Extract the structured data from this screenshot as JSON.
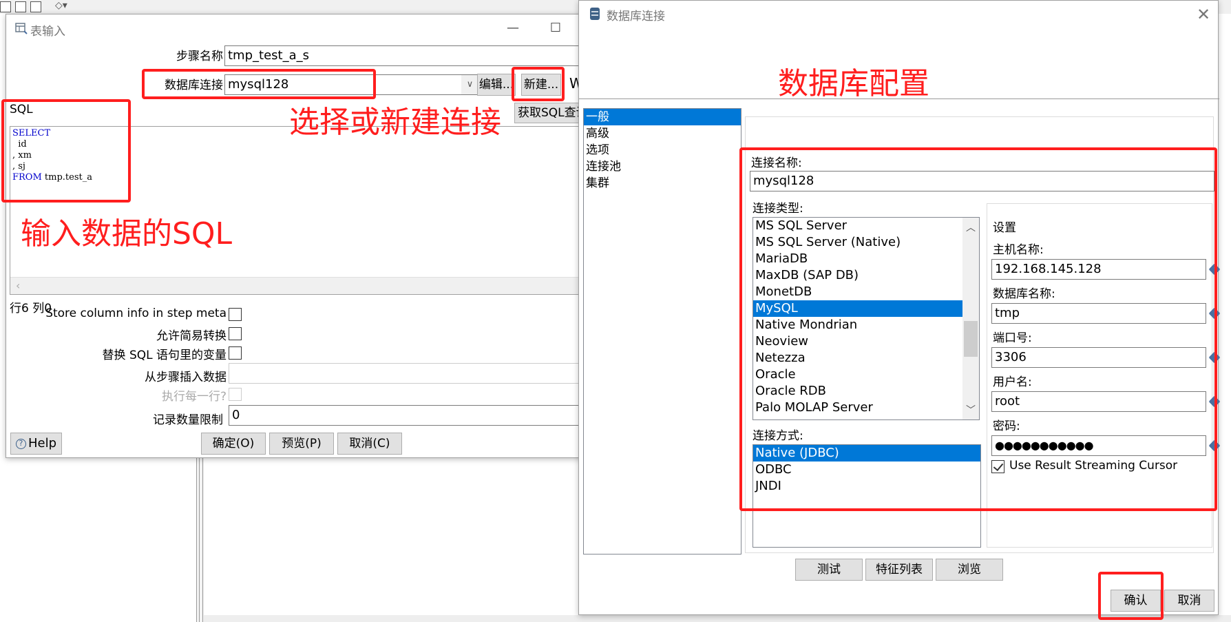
{
  "left_dialog": {
    "title": "表输入",
    "step_name_label": "步骤名称",
    "step_name_value": "tmp_test_a_s",
    "db_conn_label": "数据库连接",
    "db_conn_value": "mysql128",
    "edit_button": "编辑...",
    "new_button": "新建...",
    "wizard_button": "W",
    "get_sql_button": "获取SQL查询",
    "sql_label": "SQL",
    "sql_lines": [
      {
        "kw": "SELECT",
        "rest": ""
      },
      {
        "kw": "",
        "rest": "  id"
      },
      {
        "kw": "",
        "rest": ", xm"
      },
      {
        "kw": "",
        "rest": ", sj"
      },
      {
        "kw": "FROM",
        "rest": " tmp.test_a"
      }
    ],
    "cursor_pos": "行6 列0",
    "store_column_label": "Store column info in step meta",
    "store_column_checked": false,
    "lazy_conversion_label": "允许简易转换",
    "lazy_conversion_checked": false,
    "replace_vars_label": "替换 SQL 语句里的变量",
    "replace_vars_checked": false,
    "insert_from_step_label": "从步骤插入数据",
    "insert_from_step_value": "",
    "execute_each_row_label": "执行每一行?",
    "execute_each_row_checked": false,
    "limit_label": "记录数量限制",
    "limit_value": "0",
    "help_button": "Help",
    "ok_button": "确定(O)",
    "preview_button": "预览(P)",
    "cancel_button": "取消(C)"
  },
  "right_dialog": {
    "title": "数据库连接",
    "nav_items": [
      {
        "label": "一般",
        "selected": true
      },
      {
        "label": "高级",
        "selected": false
      },
      {
        "label": "选项",
        "selected": false
      },
      {
        "label": "连接池",
        "selected": false
      },
      {
        "label": "集群",
        "selected": false
      }
    ],
    "conn_name_label": "连接名称:",
    "conn_name_value": "mysql128",
    "conn_type_label": "连接类型:",
    "conn_types": [
      {
        "label": "MS SQL Server",
        "selected": false
      },
      {
        "label": "MS SQL Server (Native)",
        "selected": false
      },
      {
        "label": "MariaDB",
        "selected": false
      },
      {
        "label": "MaxDB (SAP DB)",
        "selected": false
      },
      {
        "label": "MonetDB",
        "selected": false
      },
      {
        "label": "MySQL",
        "selected": true
      },
      {
        "label": "Native Mondrian",
        "selected": false
      },
      {
        "label": "Neoview",
        "selected": false
      },
      {
        "label": "Netezza",
        "selected": false
      },
      {
        "label": "Oracle",
        "selected": false
      },
      {
        "label": "Oracle RDB",
        "selected": false
      },
      {
        "label": "Palo MOLAP Server",
        "selected": false
      }
    ],
    "access_label": "连接方式:",
    "access_types": [
      {
        "label": "Native (JDBC)",
        "selected": true
      },
      {
        "label": "ODBC",
        "selected": false
      },
      {
        "label": "JNDI",
        "selected": false
      }
    ],
    "settings_label": "设置",
    "host_label": "主机名称:",
    "host_value": "192.168.145.128",
    "db_name_label": "数据库名称:",
    "db_name_value": "tmp",
    "port_label": "端口号:",
    "port_value": "3306",
    "user_label": "用户名:",
    "user_value": "root",
    "password_label": "密码:",
    "password_value": "●●●●●●●●●●●",
    "streaming_cursor_label": "Use Result Streaming Cursor",
    "streaming_cursor_checked": true,
    "test_button": "测试",
    "features_button": "特征列表",
    "explore_button": "浏览",
    "ok_button": "确认",
    "cancel_button": "取消"
  },
  "annotations": {
    "sql_note": "输入数据的SQL",
    "conn_note": "选择或新建连接",
    "config_note": "数据库配置",
    "color": "#ff1e1e"
  },
  "colors": {
    "selection": "#0078d7",
    "sql_keyword": "#0000cc"
  }
}
